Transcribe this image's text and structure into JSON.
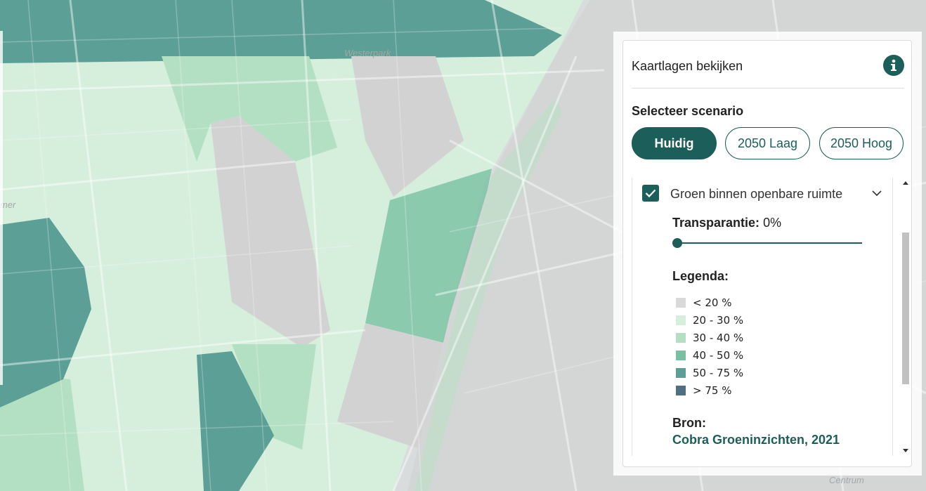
{
  "map": {
    "labels": {
      "westerpark": "Westerpark",
      "west_edge": "mer",
      "centrum": "Centrum"
    },
    "colors": {
      "lt20": "#d9d9d9",
      "c20_30": "#d6eedc",
      "c30_40": "#b3dfc3",
      "c40_50": "#79c0a2",
      "c50_75": "#5b9f96",
      "gt75": "#4f7080",
      "water": "#bcc8d6"
    }
  },
  "panel": {
    "title": "Kaartlagen bekijken",
    "info_icon": "info-icon",
    "scenario_title": "Selecteer scenario",
    "scenarios": [
      {
        "label": "Huidig",
        "active": true
      },
      {
        "label": "2050 Laag",
        "active": false
      },
      {
        "label": "2050 Hoog",
        "active": false
      }
    ],
    "layer": {
      "checked": true,
      "name": "Groen binnen openbare ruimte",
      "transparency_label": "Transparantie:",
      "transparency_value": "0%",
      "transparency_percent": 0,
      "legend_title": "Legenda:",
      "legend": [
        {
          "label": "< 20 %",
          "color": "#d9d9d9"
        },
        {
          "label": "20 - 30 %",
          "color": "#d6eedc"
        },
        {
          "label": "30 - 40 %",
          "color": "#b3dfc3"
        },
        {
          "label": "40 - 50 %",
          "color": "#79c0a2"
        },
        {
          "label": "50 - 75 %",
          "color": "#5b9f96"
        },
        {
          "label": "> 75 %",
          "color": "#4f7080"
        }
      ],
      "source_label": "Bron:",
      "source_link": "Cobra Groeninzichten, 2021"
    },
    "accent": "#1c5e59"
  }
}
